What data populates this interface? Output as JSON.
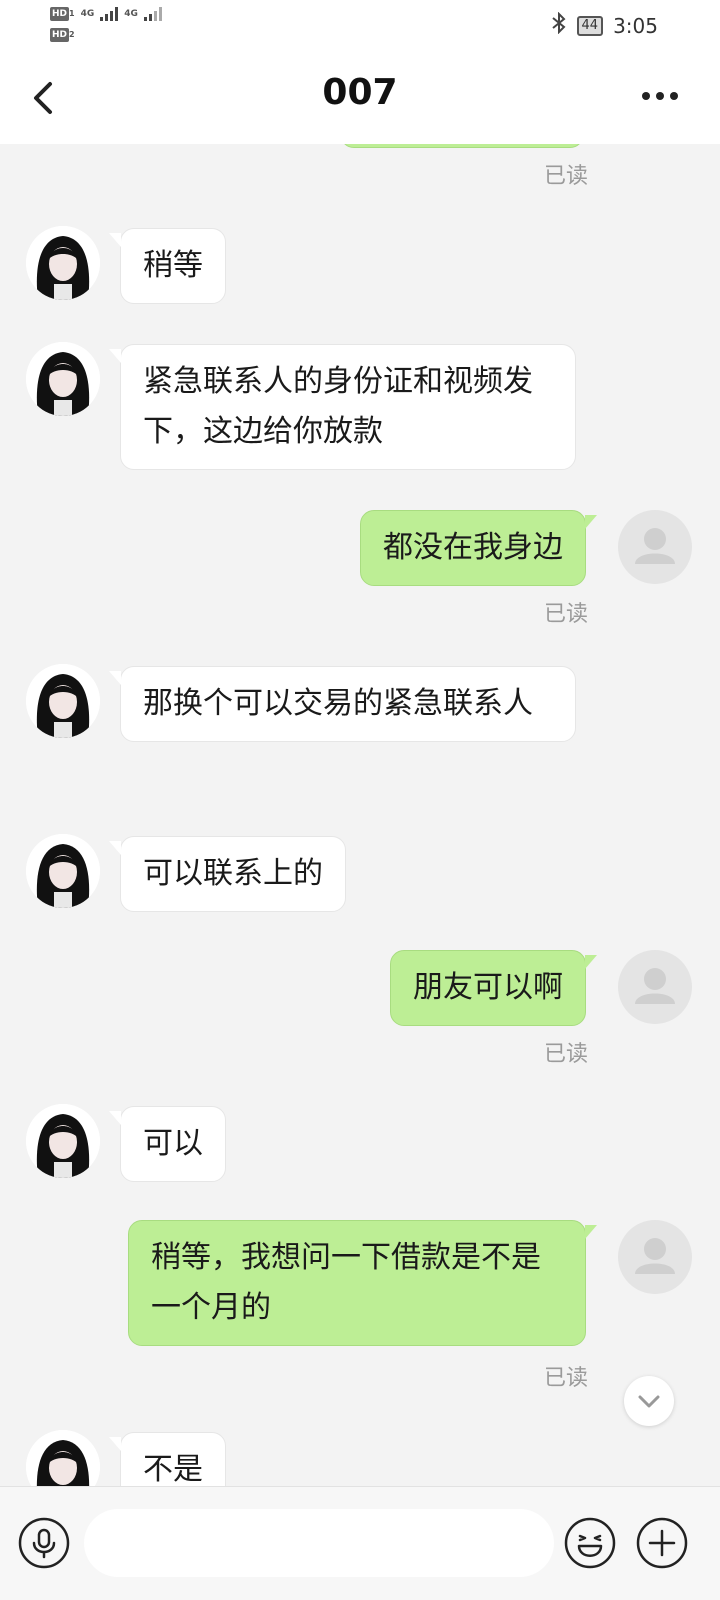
{
  "status_bar": {
    "sim1": "HD",
    "sim1_num": "1",
    "sim2": "HD",
    "sim2_num": "2",
    "net1": "4G",
    "net2": "4G",
    "battery": "44",
    "time": "3:05",
    "icons": [
      "bluetooth-icon",
      "signal-icon",
      "battery-icon"
    ]
  },
  "header": {
    "title": "007",
    "back_icon": "chevron-left-icon",
    "more_icon": "more-dots-icon"
  },
  "messages": [
    {
      "dir": "out",
      "text": "",
      "read": "已读"
    },
    {
      "dir": "in",
      "text": "稍等"
    },
    {
      "dir": "in",
      "text": "紧急联系人的身份证和视频发下，这边给你放款"
    },
    {
      "dir": "out",
      "text": "都没在我身边",
      "read": "已读"
    },
    {
      "dir": "in",
      "text": "那换个可以交易的紧急联系人"
    },
    {
      "dir": "in",
      "text": "可以联系上的"
    },
    {
      "dir": "out",
      "text": "朋友可以啊",
      "read": "已读"
    },
    {
      "dir": "in",
      "text": "可以"
    },
    {
      "dir": "out",
      "text": "稍等，我想问一下借款是不是一个月的",
      "read": "已读"
    },
    {
      "dir": "in",
      "text": "不是"
    }
  ],
  "input_bar": {
    "voice_icon": "microphone-icon",
    "emoji_icon": "emoji-icon",
    "plus_icon": "plus-icon",
    "placeholder": ""
  },
  "colors": {
    "outgoing_bubble": "#bdee95",
    "incoming_bubble": "#ffffff",
    "background": "#f3f3f3"
  }
}
